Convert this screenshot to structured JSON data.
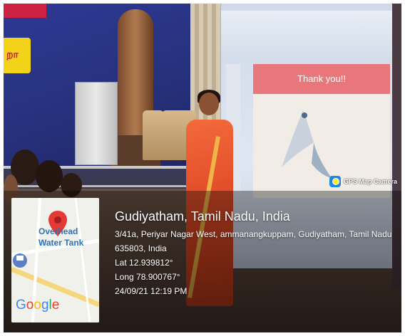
{
  "scene": {
    "slide_text": "Thank you!!",
    "banner_tag": "றா"
  },
  "gps_badge": {
    "label": "GPS Map Camera",
    "icon": "gps-map-camera-icon"
  },
  "map": {
    "label_line1": "Overhead",
    "label_line2": "Water Tank",
    "pin_icon": "map-pin-icon",
    "google": {
      "letters": [
        "G",
        "o",
        "o",
        "g",
        "l",
        "e"
      ],
      "colors": [
        "#4285F4",
        "#EA4335",
        "#FBBC05",
        "#4285F4",
        "#34A853",
        "#EA4335"
      ]
    }
  },
  "location": {
    "title": "Gudiyatham, Tamil Nadu, India",
    "address_line1": "3/41a, Periyar Nagar West, ammanangkuppam, Gudiyatham, Tamil Nadu",
    "address_line2": "635803, India",
    "lat": "Lat 12.939812°",
    "long": "Long 78.900767°",
    "datetime": "24/09/21 12:19 PM"
  }
}
